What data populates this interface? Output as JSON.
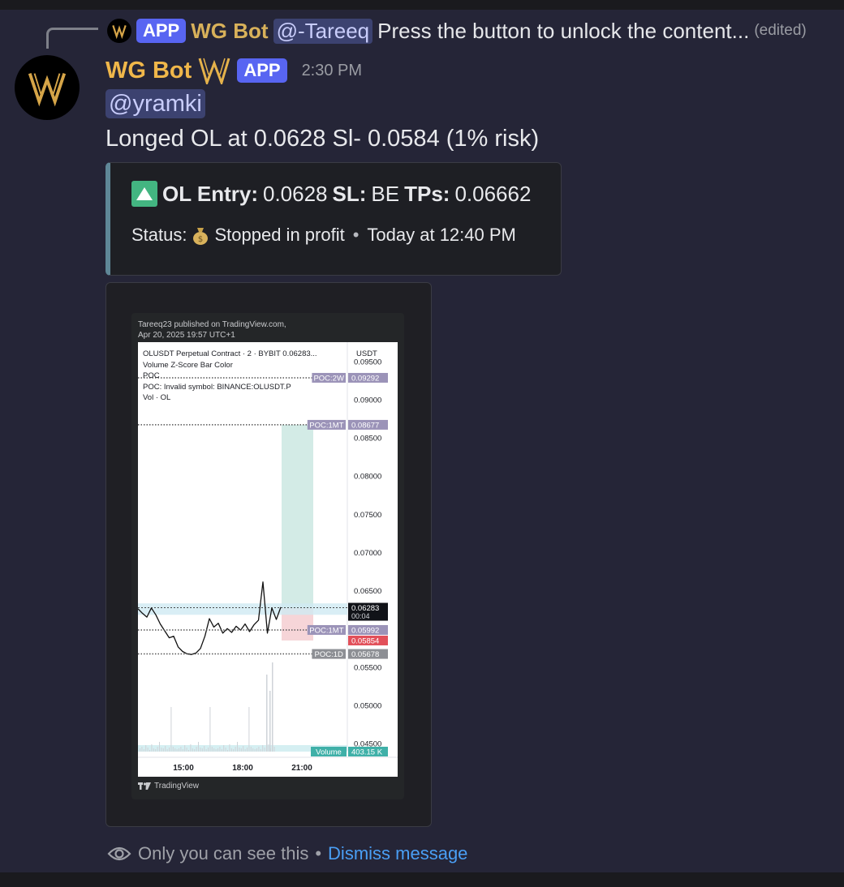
{
  "reply": {
    "app_tag": "APP",
    "bot_name": "WG Bot",
    "mention": "@-Tareeq",
    "text": "Press the button to unlock the content...",
    "edited": "(edited)"
  },
  "message": {
    "author": "WG Bot",
    "app_tag": "APP",
    "timestamp": "2:30 PM",
    "mention": "@yramki",
    "content": "Longed OL at 0.0628 Sl- 0.0584 (1% risk)"
  },
  "embed": {
    "symbol_entry": "OL Entry:",
    "entry_value": "0.0628",
    "sl_label": "SL:",
    "sl_value": "BE",
    "tps_label": "TPs:",
    "tps_value": "0.06662",
    "status_label": "Status:",
    "status_value": "Stopped in profit",
    "status_time": "Today at 12:40 PM",
    "accent_color": "#5f8797"
  },
  "chart_image": {
    "published_line1": "Tareeq23 published on TradingView.com,",
    "published_line2": "Apr 20, 2025 19:57 UTC+1",
    "legend": [
      "OLUSDT Perpetual Contract · 2 · BYBIT  0.06283...",
      "Volume Z-Score Bar Color",
      "POC",
      "POC: Invalid symbol: BINANCE:OLUSDT.P",
      "Vol · OL"
    ],
    "currency": "USDT",
    "footer_brand": "TradingView",
    "chart_data": {
      "type": "line",
      "title": "OLUSDT Perpetual Contract · 2 · BYBIT",
      "x_ticks": [
        "15:00",
        "18:00",
        "21:00"
      ],
      "y_ticks": [
        "0.09500",
        "0.09000",
        "0.08500",
        "0.08000",
        "0.07500",
        "0.07000",
        "0.06500",
        "0.05500",
        "0.05000",
        "0.04500"
      ],
      "ylim": [
        0.044,
        0.0961
      ],
      "price_path": [
        0.0627,
        0.0621,
        0.0616,
        0.0628,
        0.0619,
        0.0607,
        0.0598,
        0.0589,
        0.0591,
        0.0577,
        0.0571,
        0.0568,
        0.0567,
        0.0569,
        0.0575,
        0.0591,
        0.0614,
        0.0603,
        0.0608,
        0.0595,
        0.0601,
        0.0596,
        0.0604,
        0.0599,
        0.0607,
        0.0597,
        0.0606,
        0.0612,
        0.0662,
        0.0595,
        0.0628,
        0.0613,
        0.0629
      ],
      "levels": [
        {
          "label": "POC:2W",
          "value": "0.09292",
          "style": "purple"
        },
        {
          "label": "POC:1MT",
          "value": "0.08677",
          "style": "purple"
        },
        {
          "label": "",
          "value": "0.06283",
          "sub": "00:04",
          "style": "black"
        },
        {
          "label": "POC:1MT",
          "value": "0.05992",
          "style": "purple"
        },
        {
          "label": "",
          "value": "0.05854",
          "style": "red"
        },
        {
          "label": "POC:1D",
          "value": "0.05678",
          "style": "gray"
        }
      ],
      "volume": {
        "label": "Volume",
        "value": "403.15 K"
      },
      "position": {
        "entry": 0.0628,
        "stop": 0.05854,
        "target": 0.08677
      }
    }
  },
  "footer": {
    "ephemeral": "Only you can see this",
    "separator": "•",
    "dismiss": "Dismiss message"
  }
}
